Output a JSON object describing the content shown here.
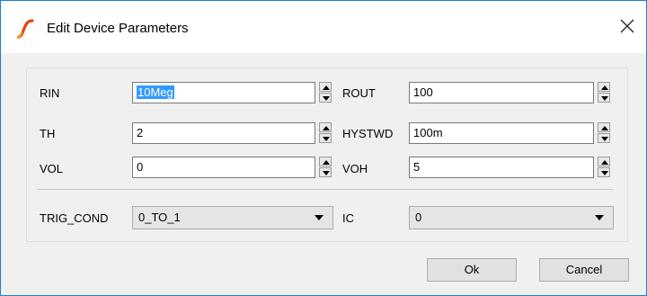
{
  "window": {
    "title": "Edit Device Parameters",
    "icon": "spice-logo-icon",
    "close_icon": "close-icon"
  },
  "params": {
    "rin": {
      "label": "RIN",
      "value": "10Meg"
    },
    "rout": {
      "label": "ROUT",
      "value": "100"
    },
    "th": {
      "label": "TH",
      "value": "2"
    },
    "hystwd": {
      "label": "HYSTWD",
      "value": "100m"
    },
    "vol": {
      "label": "VOL",
      "value": "0"
    },
    "voh": {
      "label": "VOH",
      "value": "5"
    }
  },
  "trig_cond": {
    "label": "TRIG_COND",
    "selected": "0_TO_1"
  },
  "ic": {
    "label": "IC",
    "selected": "0"
  },
  "buttons": {
    "ok": "Ok",
    "cancel": "Cancel"
  }
}
